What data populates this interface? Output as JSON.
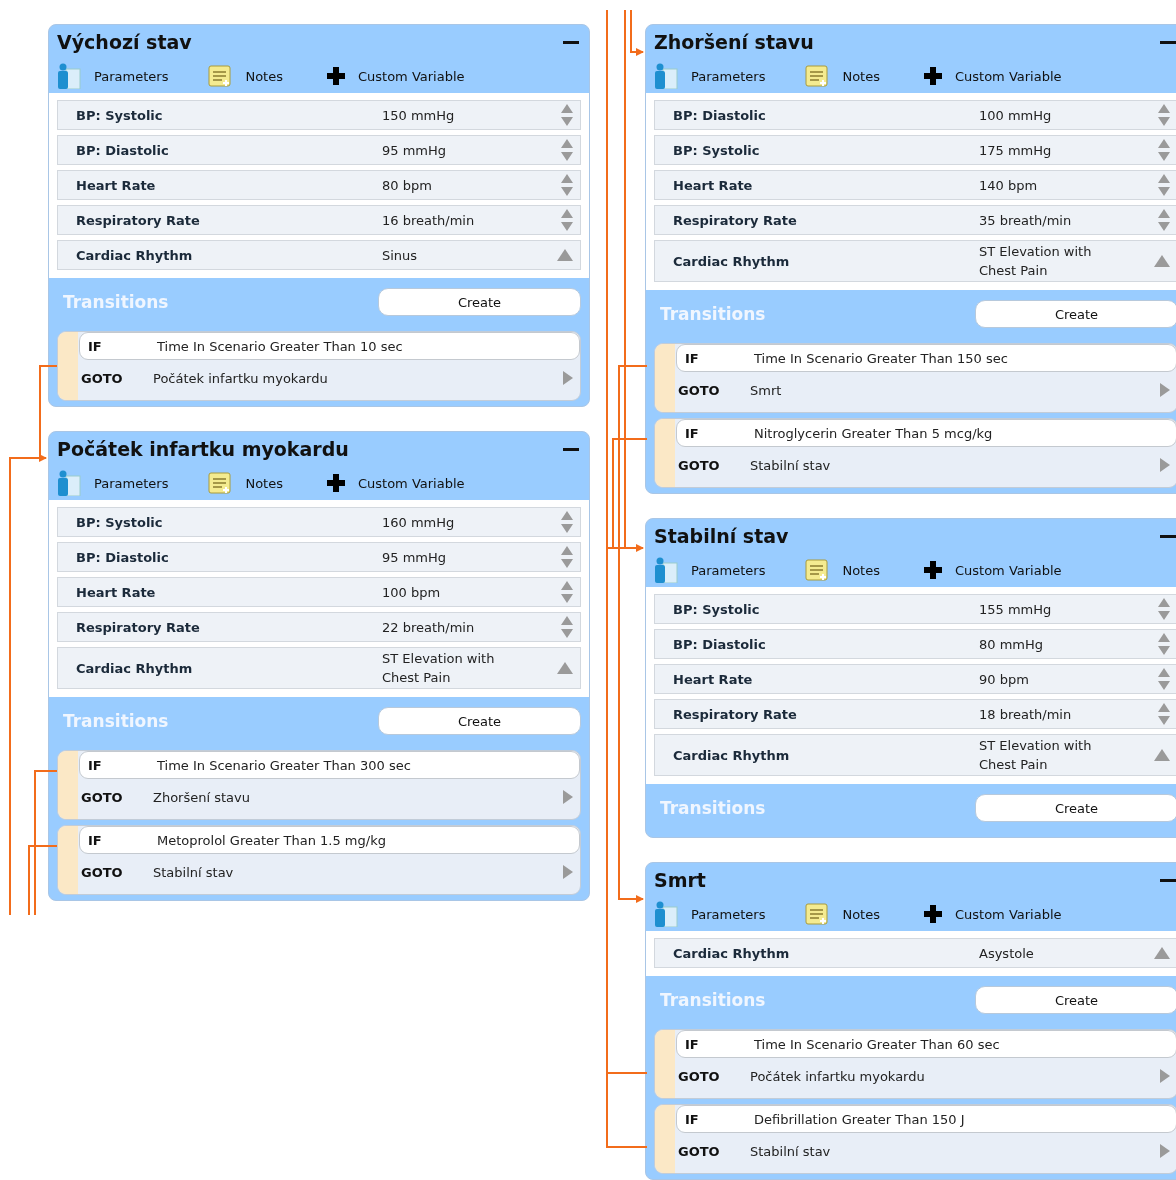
{
  "columns": [
    {
      "states": [
        {
          "title": "Výchozí stav",
          "toolbar": {
            "parameters": "Parameters",
            "notes": "Notes",
            "custom": "Custom Variable"
          },
          "parameters": [
            {
              "label": "BP: Systolic",
              "value": "150 mmHg",
              "kind": "number"
            },
            {
              "label": "BP: Diastolic",
              "value": "95 mmHg",
              "kind": "number"
            },
            {
              "label": "Heart Rate",
              "value": "80 bpm",
              "kind": "number"
            },
            {
              "label": "Respiratory Rate",
              "value": "16 breath/min",
              "kind": "number"
            },
            {
              "label": "Cardiac Rhythm",
              "value": "Sinus",
              "kind": "select"
            }
          ],
          "transitions_heading": "Transitions",
          "create_button": "Create",
          "transitions": [
            {
              "if_label": "IF",
              "condition": "Time In Scenario Greater Than 10 sec",
              "goto_label": "GOTO",
              "goto": "Počátek infartku myokardu"
            }
          ]
        },
        {
          "title": "Počátek infartku myokardu",
          "toolbar": {
            "parameters": "Parameters",
            "notes": "Notes",
            "custom": "Custom Variable"
          },
          "parameters": [
            {
              "label": "BP: Systolic",
              "value": "160 mmHg",
              "kind": "number"
            },
            {
              "label": "BP: Diastolic",
              "value": "95 mmHg",
              "kind": "number"
            },
            {
              "label": "Heart Rate",
              "value": "100 bpm",
              "kind": "number"
            },
            {
              "label": "Respiratory Rate",
              "value": "22 breath/min",
              "kind": "number"
            },
            {
              "label": "Cardiac Rhythm",
              "value": "ST Elevation with Chest Pain",
              "kind": "select"
            }
          ],
          "transitions_heading": "Transitions",
          "create_button": "Create",
          "transitions": [
            {
              "if_label": "IF",
              "condition": "Time In Scenario Greater Than 300 sec",
              "goto_label": "GOTO",
              "goto": "Zhoršení stavu"
            },
            {
              "if_label": "IF",
              "condition": "Metoprolol Greater Than 1.5 mg/kg",
              "goto_label": "GOTO",
              "goto": "Stabilní stav"
            }
          ]
        }
      ]
    },
    {
      "states": [
        {
          "title": "Zhoršení stavu",
          "toolbar": {
            "parameters": "Parameters",
            "notes": "Notes",
            "custom": "Custom Variable"
          },
          "parameters": [
            {
              "label": "BP: Diastolic",
              "value": "100 mmHg",
              "kind": "number"
            },
            {
              "label": "BP: Systolic",
              "value": "175 mmHg",
              "kind": "number"
            },
            {
              "label": "Heart Rate",
              "value": "140 bpm",
              "kind": "number"
            },
            {
              "label": "Respiratory Rate",
              "value": "35 breath/min",
              "kind": "number"
            },
            {
              "label": "Cardiac Rhythm",
              "value": "ST Elevation with Chest Pain",
              "kind": "select"
            }
          ],
          "transitions_heading": "Transitions",
          "create_button": "Create",
          "transitions": [
            {
              "if_label": "IF",
              "condition": "Time In Scenario Greater Than 150 sec",
              "goto_label": "GOTO",
              "goto": "Smrt"
            },
            {
              "if_label": "IF",
              "condition": "Nitroglycerin Greater Than 5 mcg/kg",
              "goto_label": "GOTO",
              "goto": "Stabilní stav"
            }
          ]
        },
        {
          "title": "Stabilní stav",
          "toolbar": {
            "parameters": "Parameters",
            "notes": "Notes",
            "custom": "Custom Variable"
          },
          "parameters": [
            {
              "label": "BP: Systolic",
              "value": "155 mmHg",
              "kind": "number"
            },
            {
              "label": "BP: Diastolic",
              "value": "80 mmHg",
              "kind": "number"
            },
            {
              "label": "Heart Rate",
              "value": "90 bpm",
              "kind": "number"
            },
            {
              "label": "Respiratory Rate",
              "value": "18 breath/min",
              "kind": "number"
            },
            {
              "label": "Cardiac Rhythm",
              "value": "ST Elevation with Chest Pain",
              "kind": "select"
            }
          ],
          "transitions_heading": "Transitions",
          "create_button": "Create"
        },
        {
          "title": "Smrt",
          "toolbar": {
            "parameters": "Parameters",
            "notes": "Notes",
            "custom": "Custom Variable"
          },
          "parameters": [
            {
              "label": "Cardiac Rhythm",
              "value": "Asystole",
              "kind": "select"
            }
          ],
          "transitions_heading": "Transitions",
          "create_button": "Create",
          "transitions": [
            {
              "if_label": "IF",
              "condition": "Time In Scenario Greater Than 60 sec",
              "goto_label": "GOTO",
              "goto": "Počátek infartku myokardu"
            },
            {
              "if_label": "IF",
              "condition": "Defibrillation Greater Than 150 J",
              "goto_label": "GOTO",
              "goto": "Stabilní stav"
            }
          ]
        }
      ]
    }
  ]
}
